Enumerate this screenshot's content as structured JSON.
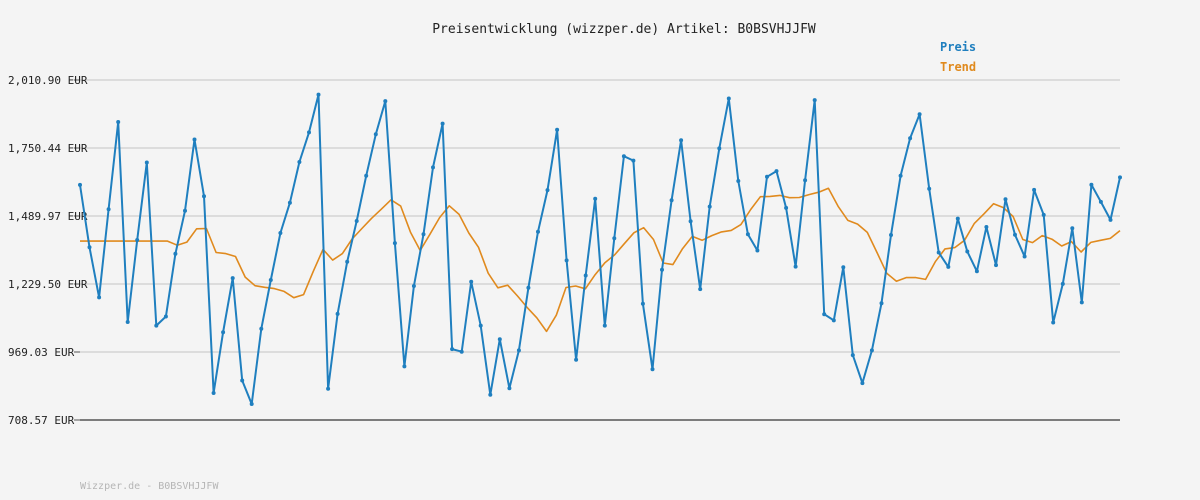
{
  "chart_data": {
    "type": "line",
    "title": "Preisentwicklung (wizzper.de) Artikel: B0BSVHJJFW",
    "ylabel": "",
    "xlabel": "",
    "ylim": [
      708.57,
      2010.9
    ],
    "yticks": [
      "2,010.90 EUR",
      "1,750.44 EUR",
      "1,489.97 EUR",
      "1,229.50 EUR",
      "969.03 EUR",
      "708.57 EUR"
    ],
    "grid": true,
    "legend_position": "top-right",
    "colors": {
      "preis": "#1f7fbf",
      "trend": "#e08a1e",
      "grid": "#dcdcdc",
      "axis": "#555555"
    },
    "series": [
      {
        "name": "Preis",
        "values": [
          1609,
          1370,
          1178,
          1516,
          1850,
          1084,
          1398,
          1695,
          1070,
          1105,
          1345,
          1510,
          1783,
          1566,
          812,
          1045,
          1252,
          860,
          770,
          1058,
          1245,
          1425,
          1541,
          1697,
          1810,
          1955,
          828,
          1115,
          1315,
          1471,
          1644,
          1803,
          1930,
          1386,
          914,
          1222,
          1420,
          1676,
          1844,
          980,
          970,
          1238,
          1070,
          805,
          1018,
          830,
          975,
          1215,
          1430,
          1589,
          1820,
          1320,
          939,
          1262,
          1556,
          1070,
          1405,
          1719,
          1702,
          1154,
          903,
          1284,
          1550,
          1780,
          1470,
          1210,
          1526,
          1749,
          1940,
          1624,
          1420,
          1358,
          1640,
          1662,
          1521,
          1296,
          1627,
          1934,
          1114,
          1090,
          1294,
          957,
          850,
          975,
          1156,
          1417,
          1644,
          1788,
          1880,
          1594,
          1350,
          1295,
          1480,
          1354,
          1278,
          1448,
          1302,
          1554,
          1418,
          1335,
          1590,
          1494,
          1082,
          1230,
          1443,
          1159,
          1610,
          1544,
          1475,
          1638
        ]
      },
      {
        "name": "Trend",
        "values": [
          1394,
          1394,
          1394,
          1394,
          1394,
          1394,
          1394,
          1394,
          1394,
          1394,
          1378,
          1390,
          1441,
          1442,
          1350,
          1346,
          1335,
          1256,
          1223,
          1217,
          1212,
          1201,
          1177,
          1189,
          1278,
          1362,
          1321,
          1346,
          1402,
          1442,
          1481,
          1516,
          1552,
          1528,
          1428,
          1358,
          1420,
          1484,
          1529,
          1496,
          1425,
          1370,
          1271,
          1215,
          1225,
          1184,
          1140,
          1100,
          1048,
          1110,
          1216,
          1222,
          1211,
          1265,
          1311,
          1341,
          1384,
          1426,
          1445,
          1400,
          1310,
          1304,
          1365,
          1412,
          1397,
          1415,
          1429,
          1435,
          1457,
          1515,
          1564,
          1565,
          1569,
          1560,
          1561,
          1572,
          1581,
          1596,
          1527,
          1473,
          1459,
          1427,
          1350,
          1271,
          1240,
          1254,
          1254,
          1247,
          1315,
          1364,
          1369,
          1397,
          1461,
          1498,
          1537,
          1522,
          1488,
          1400,
          1388,
          1415,
          1401,
          1375,
          1392,
          1352,
          1389,
          1397,
          1404,
          1434
        ]
      }
    ]
  },
  "legend": {
    "preis_label": "Preis",
    "trend_label": "Trend"
  },
  "footer": {
    "text": "Wizzper.de - B0BSVHJJFW"
  }
}
